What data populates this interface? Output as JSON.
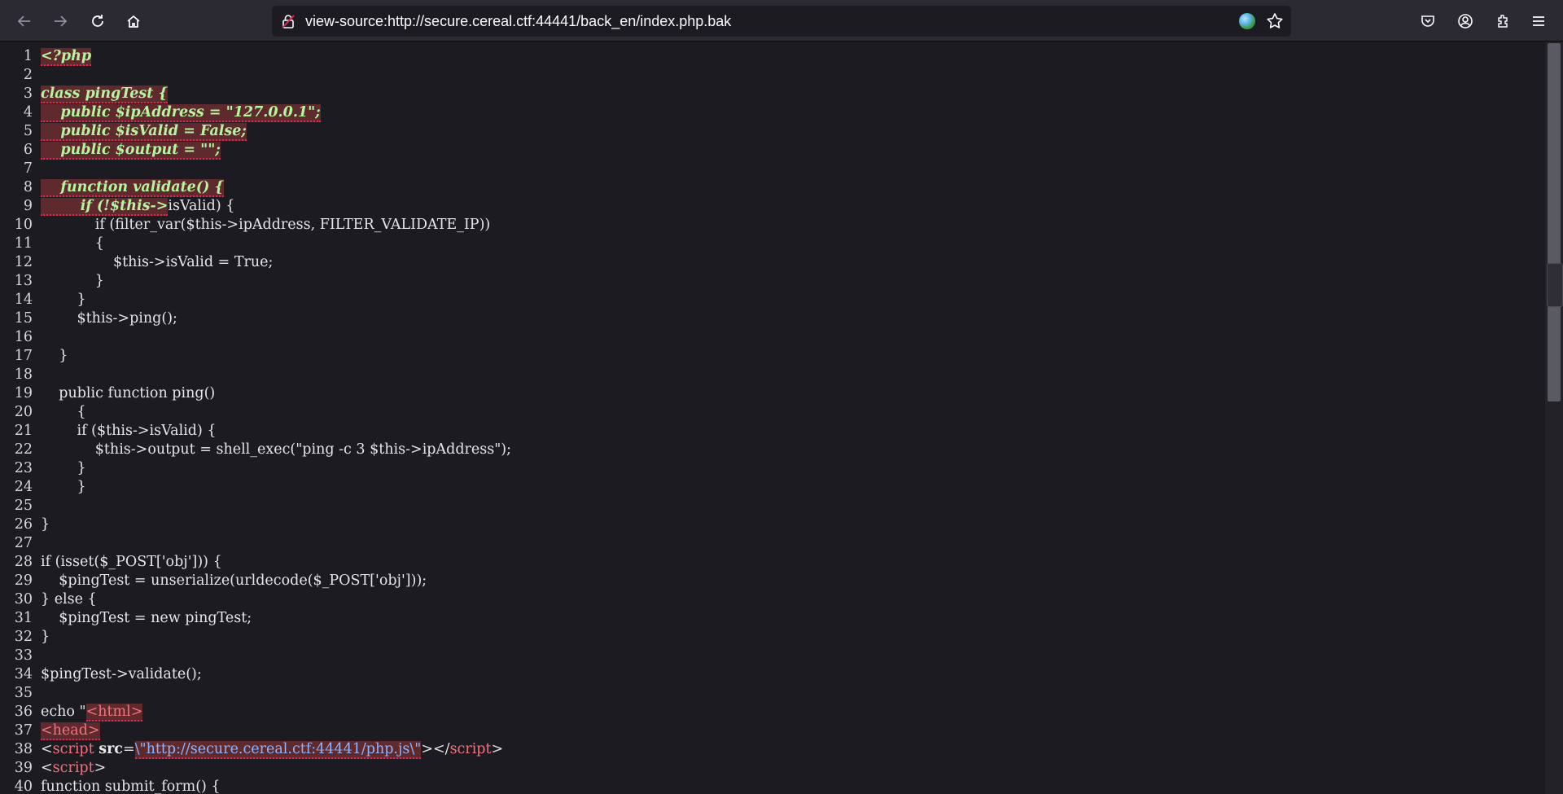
{
  "toolbar": {
    "icons": [
      "back-arrow-icon",
      "forward-arrow-icon",
      "reload-icon",
      "home-icon",
      "lock-warning-icon",
      "globe-icon",
      "bookmark-star-icon",
      "pocket-icon",
      "account-icon",
      "extensions-icon",
      "menu-icon"
    ],
    "url": "view-source:http://secure.cereal.ctf:44441/back_en/index.php.bak"
  },
  "source_lines": [
    {
      "n": "1",
      "segments": [
        {
          "t": "<?php",
          "k": "err"
        }
      ]
    },
    {
      "n": "2",
      "segments": []
    },
    {
      "n": "3",
      "segments": [
        {
          "t": "class pingTest {",
          "k": "err"
        }
      ]
    },
    {
      "n": "4",
      "segments": [
        {
          "t": "    public $ipAddress = \"127.0.0.1\";",
          "k": "err"
        }
      ]
    },
    {
      "n": "5",
      "segments": [
        {
          "t": "    public $isValid = False;",
          "k": "err"
        }
      ]
    },
    {
      "n": "6",
      "segments": [
        {
          "t": "    public $output = \"\";",
          "k": "err"
        }
      ]
    },
    {
      "n": "7",
      "segments": []
    },
    {
      "n": "8",
      "segments": [
        {
          "t": "    function validate() {",
          "k": "err"
        }
      ]
    },
    {
      "n": "9",
      "segments": [
        {
          "t": "        if (!$this->",
          "k": "err"
        },
        {
          "t": "isValid) {",
          "k": "code"
        }
      ]
    },
    {
      "n": "10",
      "segments": [
        {
          "t": "            if (filter_var($this->ipAddress, FILTER_VALIDATE_IP))",
          "k": "code"
        }
      ]
    },
    {
      "n": "11",
      "segments": [
        {
          "t": "            {",
          "k": "code"
        }
      ]
    },
    {
      "n": "12",
      "segments": [
        {
          "t": "                $this->isValid = True;",
          "k": "code"
        }
      ]
    },
    {
      "n": "13",
      "segments": [
        {
          "t": "            }",
          "k": "code"
        }
      ]
    },
    {
      "n": "14",
      "segments": [
        {
          "t": "        }",
          "k": "code"
        }
      ]
    },
    {
      "n": "15",
      "segments": [
        {
          "t": "        $this->ping();",
          "k": "code"
        }
      ]
    },
    {
      "n": "16",
      "segments": []
    },
    {
      "n": "17",
      "segments": [
        {
          "t": "    }",
          "k": "code"
        }
      ]
    },
    {
      "n": "18",
      "segments": []
    },
    {
      "n": "19",
      "segments": [
        {
          "t": "    public function ping()",
          "k": "code"
        }
      ]
    },
    {
      "n": "20",
      "segments": [
        {
          "t": "        {",
          "k": "code"
        }
      ]
    },
    {
      "n": "21",
      "segments": [
        {
          "t": "        if ($this->isValid) {",
          "k": "code"
        }
      ]
    },
    {
      "n": "22",
      "segments": [
        {
          "t": "            $this->output = shell_exec(\"ping -c 3 $this->ipAddress\");",
          "k": "code"
        }
      ]
    },
    {
      "n": "23",
      "segments": [
        {
          "t": "        }",
          "k": "code"
        }
      ]
    },
    {
      "n": "24",
      "segments": [
        {
          "t": "        }",
          "k": "code"
        }
      ]
    },
    {
      "n": "25",
      "segments": []
    },
    {
      "n": "26",
      "segments": [
        {
          "t": "}",
          "k": "code"
        }
      ]
    },
    {
      "n": "27",
      "segments": []
    },
    {
      "n": "28",
      "segments": [
        {
          "t": "if (isset($_POST['obj'])) {",
          "k": "code"
        }
      ]
    },
    {
      "n": "29",
      "segments": [
        {
          "t": "    $pingTest = unserialize(urldecode($_POST['obj']));",
          "k": "code"
        }
      ]
    },
    {
      "n": "30",
      "segments": [
        {
          "t": "} else {",
          "k": "code"
        }
      ]
    },
    {
      "n": "31",
      "segments": [
        {
          "t": "    $pingTest = new pingTest;",
          "k": "code"
        }
      ]
    },
    {
      "n": "32",
      "segments": [
        {
          "t": "}",
          "k": "code"
        }
      ]
    },
    {
      "n": "33",
      "segments": []
    },
    {
      "n": "34",
      "segments": [
        {
          "t": "$pingTest->validate();",
          "k": "code"
        }
      ]
    },
    {
      "n": "35",
      "segments": []
    },
    {
      "n": "36",
      "segments": [
        {
          "t": "echo \"",
          "k": "code"
        },
        {
          "t": "<html>",
          "k": "tag-hl"
        }
      ]
    },
    {
      "n": "37",
      "segments": [
        {
          "t": "<head>",
          "k": "tag-hl"
        }
      ]
    },
    {
      "n": "38",
      "segments": [
        {
          "t": "<",
          "k": "code"
        },
        {
          "t": "script ",
          "k": "tag"
        },
        {
          "t": "src",
          "k": "attr"
        },
        {
          "t": "=",
          "k": "code"
        },
        {
          "t": "\\\"http://secure.cereal.ctf:44441/php.js\\\"",
          "k": "val"
        },
        {
          "t": "></",
          "k": "code"
        },
        {
          "t": "script",
          "k": "tag"
        },
        {
          "t": ">",
          "k": "code"
        }
      ]
    },
    {
      "n": "39",
      "segments": [
        {
          "t": "<",
          "k": "code"
        },
        {
          "t": "script",
          "k": "tag"
        },
        {
          "t": ">",
          "k": "code"
        }
      ]
    },
    {
      "n": "40",
      "segments": [
        {
          "t": "function submit_form() {",
          "k": "code"
        }
      ]
    }
  ]
}
